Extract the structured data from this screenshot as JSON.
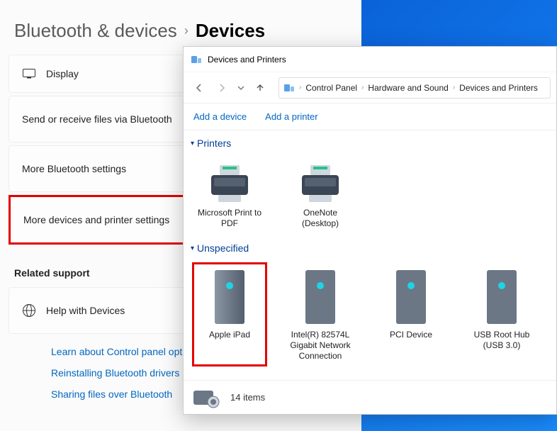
{
  "settings": {
    "breadcrumb_parent": "Bluetooth & devices",
    "breadcrumb_current": "Devices",
    "rows": {
      "display": "Display",
      "send_files": "Send or receive files via Bluetooth",
      "more_bt": "More Bluetooth settings",
      "more_dev": "More devices and printer settings"
    },
    "related_label": "Related support",
    "help_label": "Help with Devices",
    "links": {
      "l1": "Learn about Control panel options",
      "l2": "Reinstalling Bluetooth drivers",
      "l3": "Sharing files over Bluetooth"
    }
  },
  "explorer": {
    "title": "Devices and Printers",
    "address": {
      "seg1": "Control Panel",
      "seg2": "Hardware and Sound",
      "seg3": "Devices and Printers"
    },
    "commands": {
      "add_device": "Add a device",
      "add_printer": "Add a printer"
    },
    "groups": {
      "printers": "Printers",
      "unspecified": "Unspecified"
    },
    "items": {
      "p1": "Microsoft Print to PDF",
      "p2": "OneNote (Desktop)",
      "u1": "Apple iPad",
      "u2": "Intel(R) 82574L Gigabit Network Connection",
      "u3": "PCI Device",
      "u4": "USB Root Hub (USB 3.0)"
    },
    "status": "14 items"
  }
}
